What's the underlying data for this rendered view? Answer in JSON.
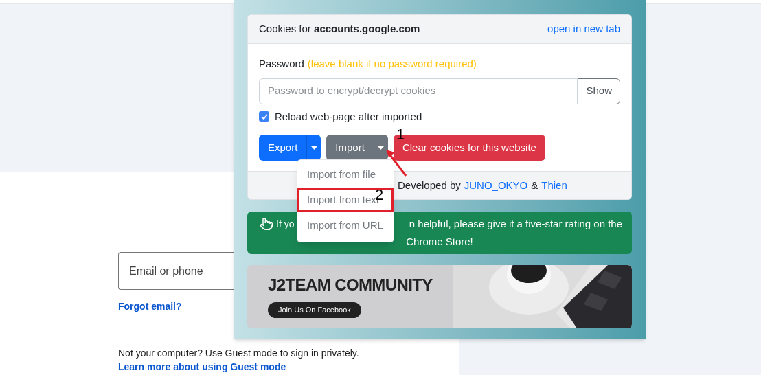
{
  "google": {
    "email_field": {
      "placeholder": "Email or phone"
    },
    "forgot_link": "Forgot email?",
    "guest_note": "Not your computer? Use Guest mode to sign in privately.",
    "guest_link": "Learn more about using Guest mode"
  },
  "popup": {
    "header": {
      "title": "Cookies for **accounts.google.com**",
      "link": "open in new tab"
    },
    "password": {
      "label": "Password",
      "hint": "(leave blank if no password required)",
      "placeholder": "Password to encrypt/decrypt cookies",
      "show_button": "Show"
    },
    "reload": {
      "label": "Reload web-page after imported",
      "checked": true
    },
    "buttons": [
      {
        "label": "Export",
        "kind": "split",
        "color": "#0d6efd"
      },
      {
        "label": "Import",
        "kind": "split",
        "color": "#6c757d"
      },
      {
        "label": "Clear cookies for this website",
        "kind": "plain",
        "color": "#dc3545"
      }
    ],
    "import_menu": [
      {
        "label": "Import from file",
        "highlighted": false
      },
      {
        "label": "Import from text",
        "highlighted": true
      },
      {
        "label": "Import from URL",
        "highlighted": false
      }
    ],
    "footer": {
      "prefix": "Developed by",
      "author_1": "JUNO_OKYO",
      "joiner": "&",
      "author_2": "Thien"
    },
    "alert": {
      "start": "If yo",
      "end": "n helpful, please give it a five-star rating on the",
      "line_2": "Chrome Store!"
    },
    "banner": {
      "title": "J2TEAM COMMUNITY",
      "button": "Join Us On Facebook"
    }
  },
  "annotations": [
    {
      "label": "1"
    },
    {
      "label": "2"
    }
  ]
}
